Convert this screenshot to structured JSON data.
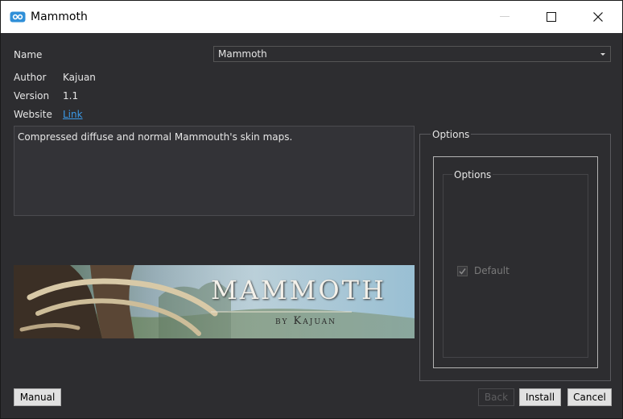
{
  "window": {
    "title": "Mammoth"
  },
  "form": {
    "name_label": "Name",
    "name_value": "Mammoth",
    "author_label": "Author",
    "author_value": "Kajuan",
    "version_label": "Version",
    "version_value": "1.1",
    "website_label": "Website",
    "website_link": "Link"
  },
  "description": "Compressed diffuse and normal Mammouth's skin maps.",
  "banner": {
    "title": "Mammoth",
    "subtitle": "by Kajuan"
  },
  "options": {
    "outer_title": "Options",
    "inner_title": "Options",
    "checkbox_label": "Default",
    "checkbox_checked": true
  },
  "buttons": {
    "manual": "Manual",
    "back": "Back",
    "install": "Install",
    "cancel": "Cancel"
  },
  "colors": {
    "background": "#2d2d30",
    "link": "#3b9bea",
    "titlebar": "#ffffff"
  }
}
